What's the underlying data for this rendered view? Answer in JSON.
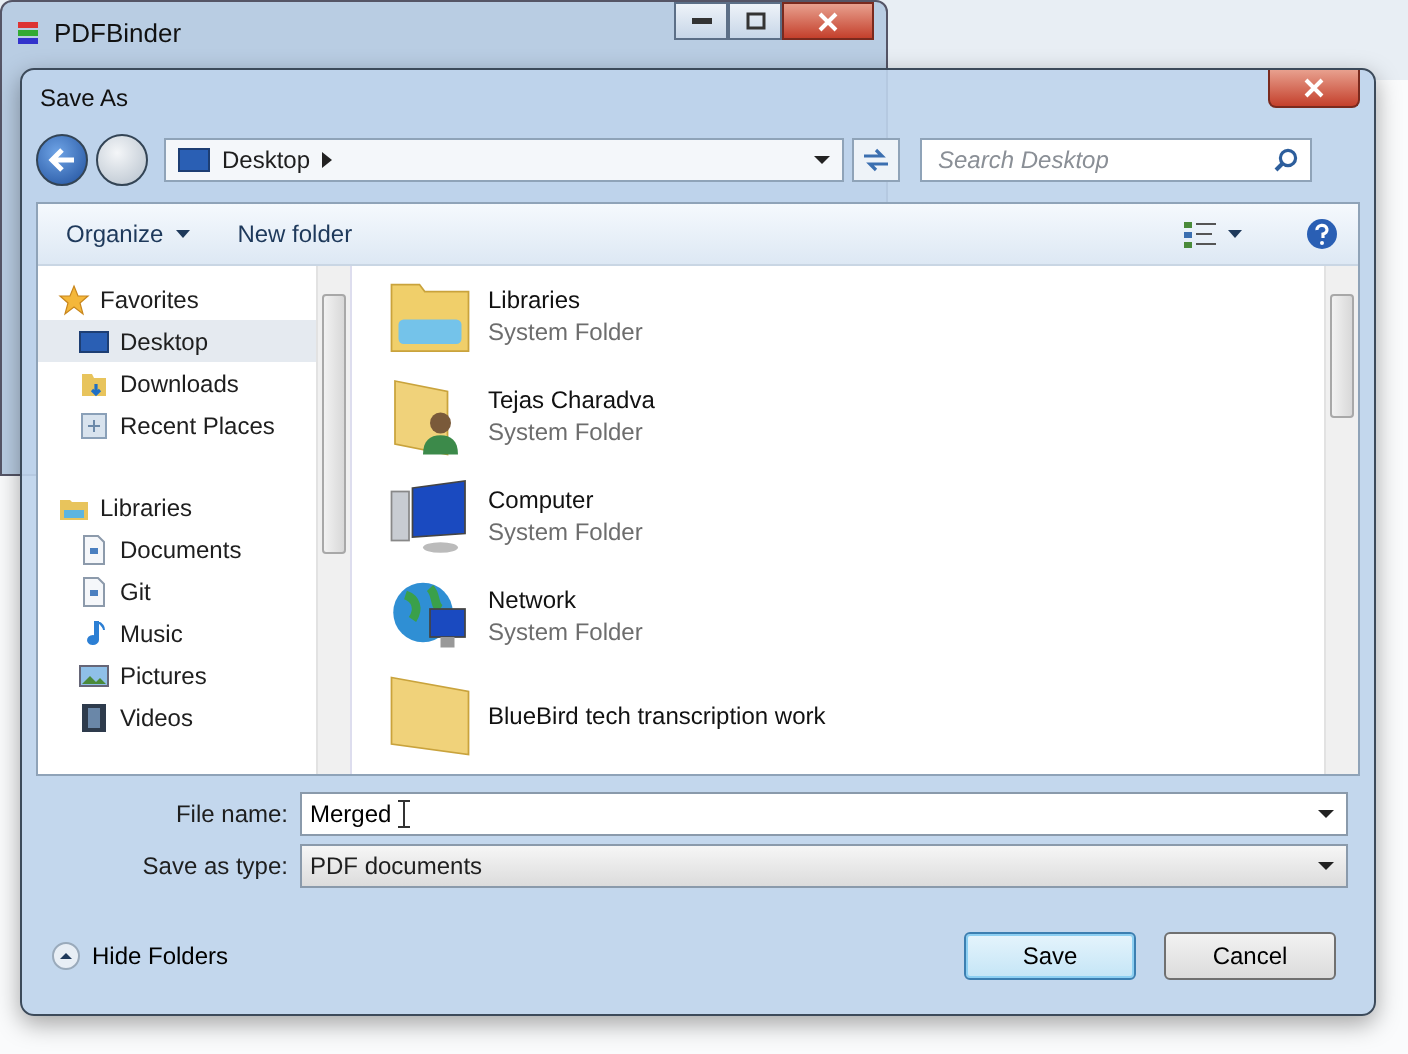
{
  "background_window": {
    "title": "PDFBinder"
  },
  "dialog": {
    "title": "Save As",
    "address": {
      "location": "Desktop"
    },
    "search": {
      "placeholder": "Search Desktop"
    },
    "toolbar": {
      "organize": "Organize",
      "new_folder": "New folder"
    },
    "nav": [
      {
        "label": "Favorites",
        "kind": "star",
        "selected": false,
        "children": [
          {
            "label": "Desktop",
            "kind": "desktop",
            "selected": true
          },
          {
            "label": "Downloads",
            "kind": "downloads",
            "selected": false
          },
          {
            "label": "Recent Places",
            "kind": "recent",
            "selected": false
          }
        ]
      },
      {
        "label": "Libraries",
        "kind": "libraries",
        "selected": false,
        "children": [
          {
            "label": "Documents",
            "kind": "document",
            "selected": false
          },
          {
            "label": "Git",
            "kind": "document",
            "selected": false
          },
          {
            "label": "Music",
            "kind": "music",
            "selected": false
          },
          {
            "label": "Pictures",
            "kind": "pictures",
            "selected": false
          },
          {
            "label": "Videos",
            "kind": "videos",
            "selected": false
          }
        ]
      }
    ],
    "items": [
      {
        "name": "Libraries",
        "type": "System Folder",
        "kind": "libraries"
      },
      {
        "name": "Tejas Charadva",
        "type": "System Folder",
        "kind": "user"
      },
      {
        "name": "Computer",
        "type": "System Folder",
        "kind": "computer"
      },
      {
        "name": "Network",
        "type": "System Folder",
        "kind": "network"
      },
      {
        "name": "BlueBird tech transcription work",
        "kind": "folder"
      }
    ],
    "file_name": {
      "label": "File name:",
      "value": "Merged"
    },
    "save_type": {
      "label": "Save as type:",
      "value": "PDF documents"
    },
    "hide_folders": "Hide Folders",
    "buttons": [
      "Save",
      "Cancel"
    ]
  }
}
